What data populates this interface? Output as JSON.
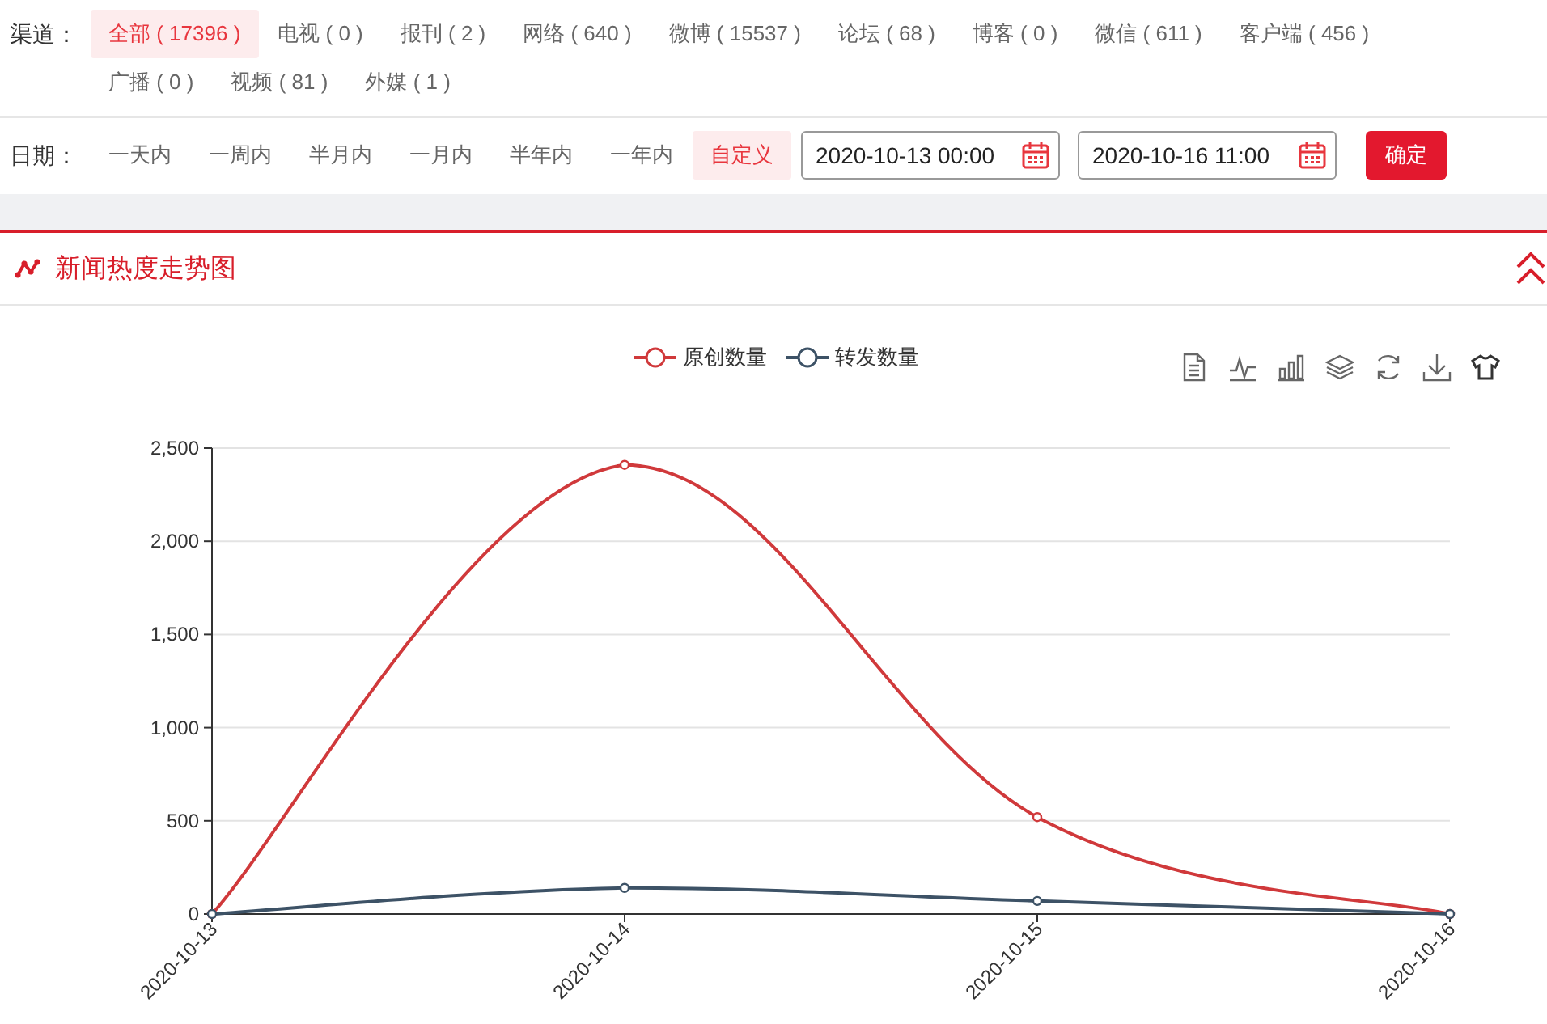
{
  "channel_filter": {
    "label": "渠道：",
    "items": [
      {
        "label": "全部 ( 17396 )",
        "selected": true
      },
      {
        "label": "电视 ( 0 )",
        "selected": false
      },
      {
        "label": "报刊 ( 2 )",
        "selected": false
      },
      {
        "label": "网络 ( 640 )",
        "selected": false
      },
      {
        "label": "微博 ( 15537 )",
        "selected": false
      },
      {
        "label": "论坛 ( 68 )",
        "selected": false
      },
      {
        "label": "博客 ( 0 )",
        "selected": false
      },
      {
        "label": "微信 ( 611 )",
        "selected": false
      },
      {
        "label": "客户端 ( 456 )",
        "selected": false
      },
      {
        "label": "广播 ( 0 )",
        "selected": false
      },
      {
        "label": "视频 ( 81 )",
        "selected": false
      },
      {
        "label": "外媒 ( 1 )",
        "selected": false
      }
    ]
  },
  "date_filter": {
    "label": "日期：",
    "items": [
      {
        "label": "一天内",
        "selected": false
      },
      {
        "label": "一周内",
        "selected": false
      },
      {
        "label": "半月内",
        "selected": false
      },
      {
        "label": "一月内",
        "selected": false
      },
      {
        "label": "半年内",
        "selected": false
      },
      {
        "label": "一年内",
        "selected": false
      },
      {
        "label": "自定义",
        "selected": true
      }
    ],
    "start": "2020-10-13 00:00",
    "end": "2020-10-16 11:00",
    "confirm": "确定"
  },
  "panel": {
    "title": "新闻热度走势图",
    "chart_data": {
      "type": "line",
      "grid": true,
      "legend": true,
      "categories": [
        "2020-10-13",
        "2020-10-14",
        "2020-10-15",
        "2020-10-16"
      ],
      "series": [
        {
          "name": "原创数量",
          "color": "#d0393b",
          "marker": "circle",
          "values": [
            0,
            2410,
            520,
            0
          ]
        },
        {
          "name": "转发数量",
          "color": "#3d5266",
          "marker": "circle",
          "values": [
            0,
            140,
            70,
            0
          ]
        }
      ],
      "ylim": [
        0,
        2500
      ],
      "yticks": [
        {
          "value": 0,
          "label": "0"
        },
        {
          "value": 500,
          "label": "500"
        },
        {
          "value": 1000,
          "label": "1,000"
        },
        {
          "value": 1500,
          "label": "1,500"
        },
        {
          "value": 2000,
          "label": "2,000"
        },
        {
          "value": 2500,
          "label": "2,500"
        }
      ]
    }
  }
}
